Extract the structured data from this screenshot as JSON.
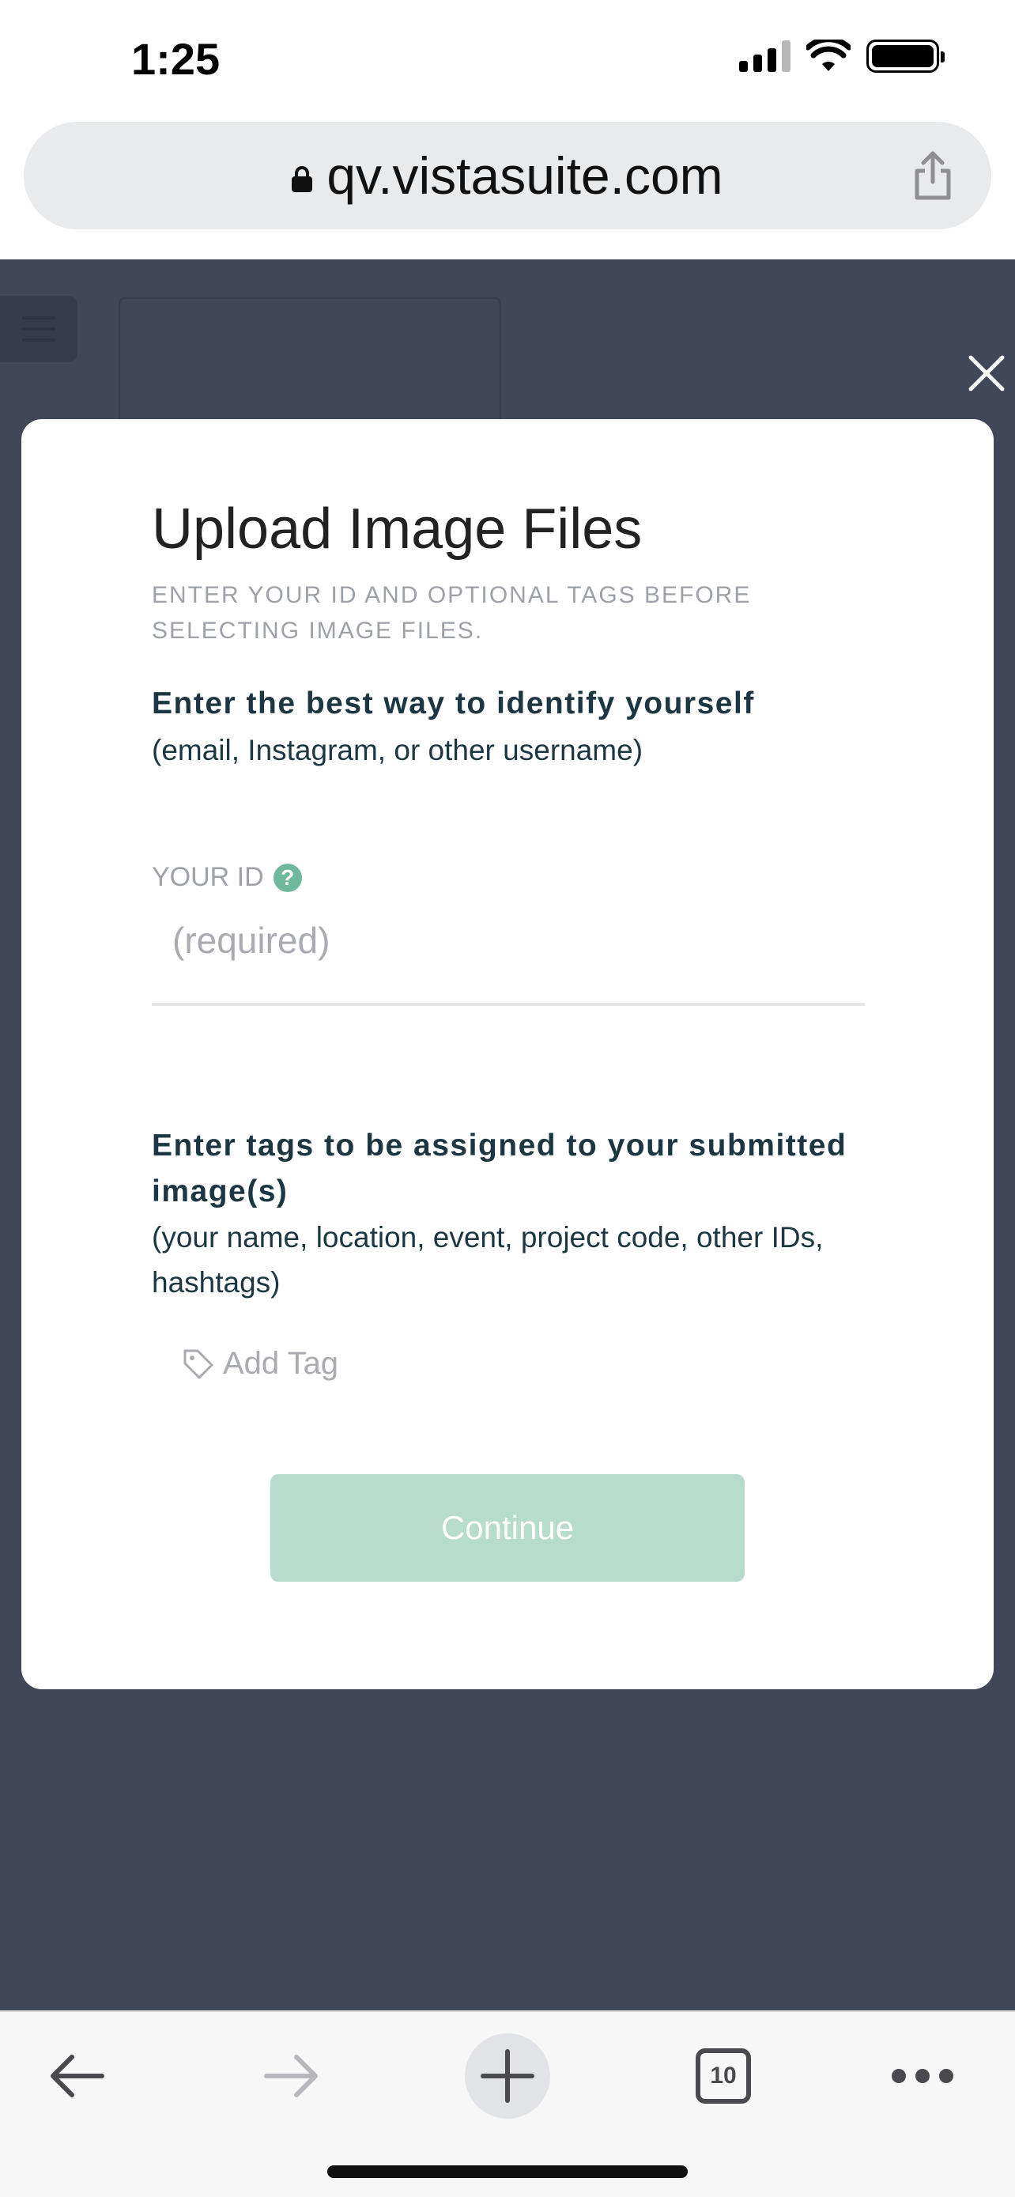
{
  "status_bar": {
    "time": "1:25",
    "icons": [
      "signal-icon",
      "wifi-icon",
      "battery-icon"
    ]
  },
  "browser": {
    "url": "qv.vistasuite.com",
    "icons": [
      "lock-icon",
      "share-icon"
    ]
  },
  "page": {
    "icons": [
      "menu-icon",
      "close-icon"
    ]
  },
  "modal": {
    "title": "Upload Image Files",
    "subtitle": "ENTER YOUR ID AND OPTIONAL TAGS BEFORE SELECTING IMAGE FILES.",
    "id_section": {
      "heading": "Enter the best way to identify yourself",
      "note": "(email, Instagram, or other username)",
      "label": "YOUR ID",
      "help_glyph": "?",
      "placeholder": "(required)",
      "value": ""
    },
    "tags_section": {
      "heading": "Enter tags to be assigned to your submitted image(s)",
      "note": "(your name, location, event, project code, other IDs, hashtags)",
      "add_tag_label": "Add Tag"
    },
    "continue_label": "Continue"
  },
  "toolbar": {
    "tab_count": "10",
    "icons": [
      "back-arrow-icon",
      "forward-arrow-icon",
      "new-tab-icon",
      "tabs-icon",
      "more-icon"
    ]
  },
  "colors": {
    "page_background": "#414658",
    "accent": "#6fb89d",
    "continue_disabled": "#b7dccd",
    "heading_text": "#1d3742"
  }
}
